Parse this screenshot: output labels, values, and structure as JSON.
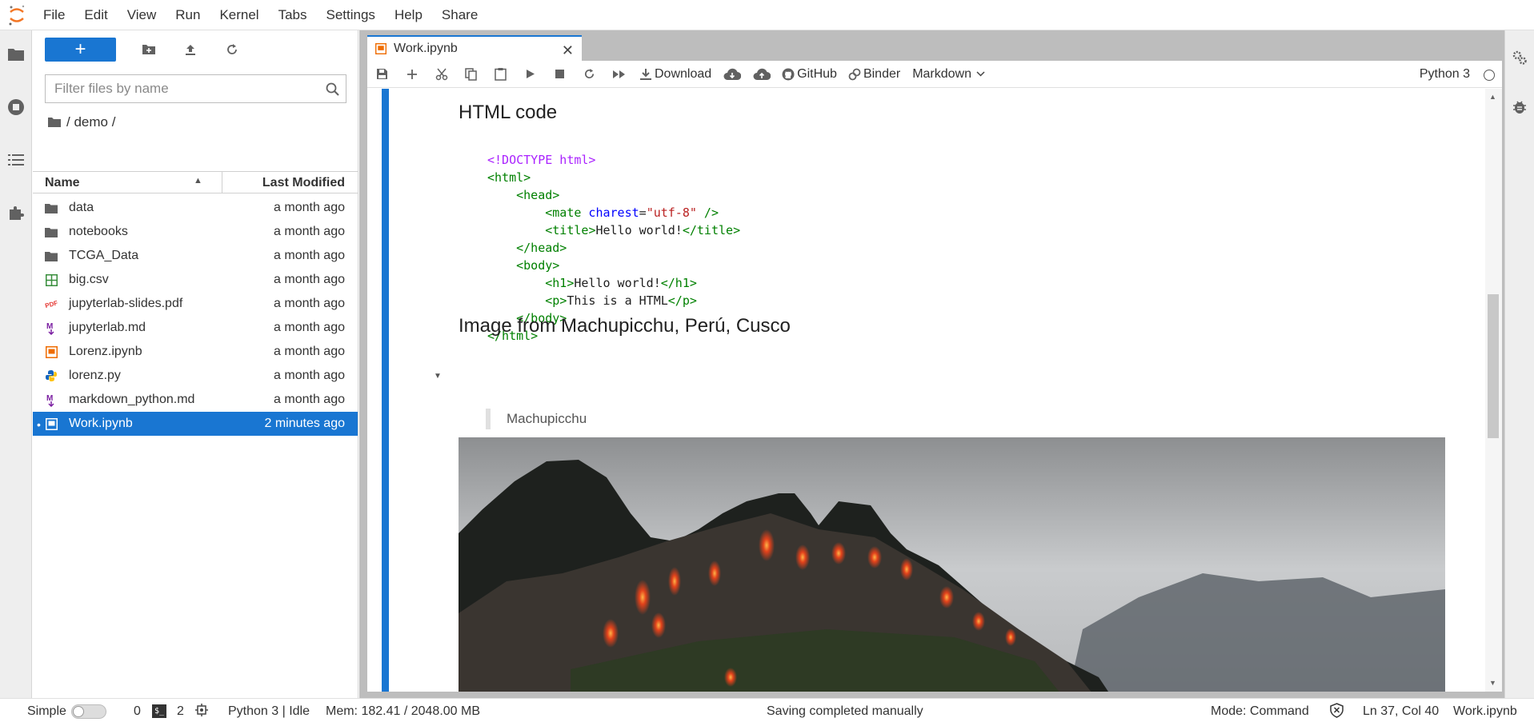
{
  "menubar": {
    "items": [
      "File",
      "Edit",
      "View",
      "Run",
      "Kernel",
      "Tabs",
      "Settings",
      "Help",
      "Share"
    ]
  },
  "filebrowser": {
    "new_label": "+",
    "filter_placeholder": "Filter files by name",
    "breadcrumb": "/ demo /",
    "header_name": "Name",
    "header_modified": "Last Modified",
    "files": [
      {
        "name": "data",
        "modified": "a month ago",
        "icon": "folder-icon"
      },
      {
        "name": "notebooks",
        "modified": "a month ago",
        "icon": "folder-icon"
      },
      {
        "name": "TCGA_Data",
        "modified": "a month ago",
        "icon": "folder-icon"
      },
      {
        "name": "big.csv",
        "modified": "a month ago",
        "icon": "spreadsheet-icon"
      },
      {
        "name": "jupyterlab-slides.pdf",
        "modified": "a month ago",
        "icon": "pdf-icon"
      },
      {
        "name": "jupyterlab.md",
        "modified": "a month ago",
        "icon": "markdown-icon"
      },
      {
        "name": "Lorenz.ipynb",
        "modified": "a month ago",
        "icon": "notebook-icon"
      },
      {
        "name": "lorenz.py",
        "modified": "a month ago",
        "icon": "python-icon"
      },
      {
        "name": "markdown_python.md",
        "modified": "a month ago",
        "icon": "markdown-icon"
      },
      {
        "name": "Work.ipynb",
        "modified": "2 minutes ago",
        "icon": "notebook-icon",
        "selected": true
      }
    ]
  },
  "tab": {
    "label": "Work.ipynb"
  },
  "toolbar": {
    "download": "Download",
    "github": "GitHub",
    "binder": "Binder",
    "cell_type": "Markdown",
    "kernel": "Python 3"
  },
  "notebook": {
    "heading1": "HTML code",
    "code_lines": [
      "<!DOCTYPE html>",
      "<html>",
      "    <head>",
      "        <mate charest=\"utf-8\" />",
      "        <title>Hello world!</title>",
      "    </head>",
      "    <body>",
      "        <h1>Hello world!</h1>",
      "        <p>This is a HTML</p>",
      "    </body>",
      "</html>"
    ],
    "heading2": "Image from Machupicchu, Perú, Cusco",
    "quote": "Machupicchu"
  },
  "statusbar": {
    "mode_label": "Simple",
    "count1": "0",
    "count2": "2",
    "kernel_status": "Python 3 | Idle",
    "memory": "Mem: 182.41 / 2048.00 MB",
    "message": "Saving completed manually",
    "mode": "Mode: Command",
    "position": "Ln 37, Col 40",
    "filename": "Work.ipynb"
  },
  "colors": {
    "accent": "#1976d2",
    "folder": "#616161",
    "csv": "#388e3c",
    "pdf": "#e53935",
    "markdown": "#7b1fa2",
    "notebook": "#ef6c00",
    "python": "#1565c0"
  }
}
